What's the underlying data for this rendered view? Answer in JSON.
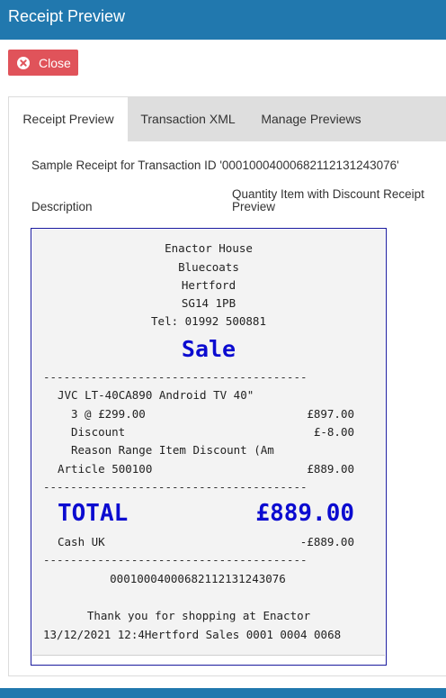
{
  "window": {
    "title": "Receipt Preview"
  },
  "toolbar": {
    "close_label": "Close"
  },
  "tabs": [
    {
      "label": "Receipt Preview",
      "active": true
    },
    {
      "label": "Transaction XML",
      "active": false
    },
    {
      "label": "Manage Previews",
      "active": false
    }
  ],
  "content": {
    "sample_text": "Sample Receipt for Transaction ID '000100040006821121312430​76'",
    "description_label": "Description",
    "description_value_line1": "Quantity Item with Discount Receipt",
    "description_value_line2": "Preview"
  },
  "receipt": {
    "header_lines": [
      "Enactor House",
      "Bluecoats",
      "Hertford",
      "SG14 1PB",
      "Tel: 01992 500881"
    ],
    "sale_title": "Sale",
    "separator": "---------------------------------------",
    "item_name": "JVC LT-40CA890 Android TV 40\"",
    "qty_price": "3 @ £299.00",
    "qty_amount": "£897.00",
    "discount_label": "Discount",
    "discount_amount": "£-8.00",
    "reason": "Reason Range Item Discount (Am",
    "article": "Article 500100",
    "article_amount": "£889.00",
    "total_label": "TOTAL",
    "total_amount": "£889.00",
    "tender_label": "Cash UK",
    "tender_amount": "-£889.00",
    "transaction_id": "000100040006821121312430​76",
    "thanks": "Thank you for shopping at Enactor",
    "footer": "13/12/2021 12:4Hertford Sales 0001 0004 0068"
  },
  "colors": {
    "title_bar": "#2178ae",
    "close_button": "#e0535a",
    "receipt_accent": "#0b0bd0"
  }
}
